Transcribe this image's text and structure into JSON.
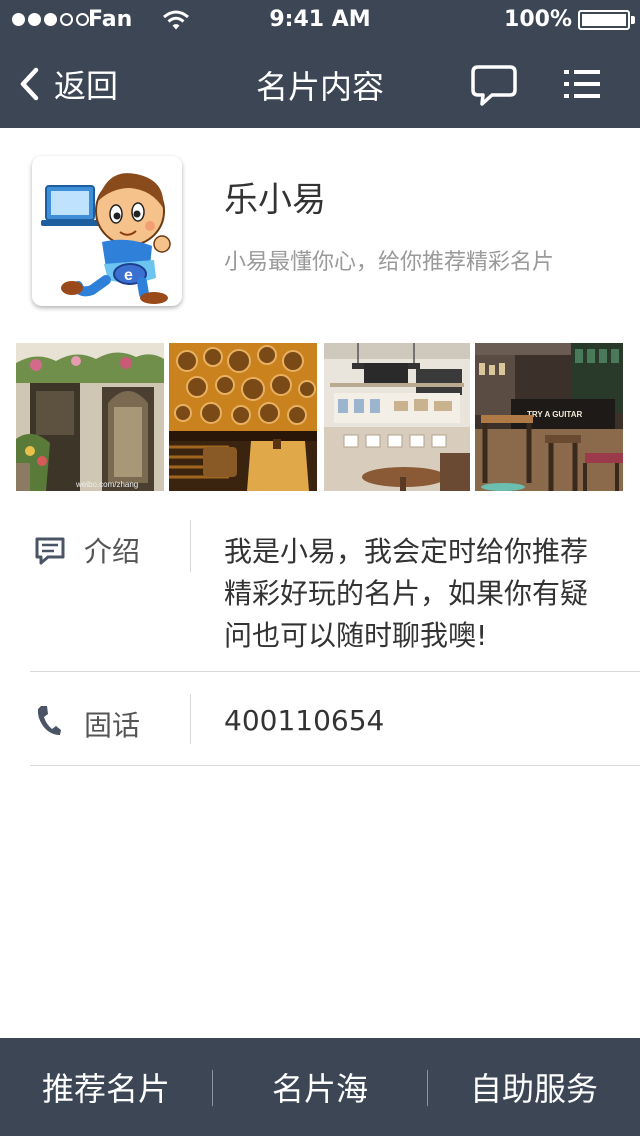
{
  "status_bar": {
    "carrier": "Fan",
    "time": "9:41 AM",
    "battery": "100%"
  },
  "nav": {
    "back_label": "返回",
    "title": "名片内容",
    "icons": [
      "chevron-left-icon",
      "chat-bubble-icon",
      "list-menu-icon"
    ]
  },
  "profile": {
    "name": "乐小易",
    "tagline": "小易最懂你心，给你推荐精彩名片",
    "avatar_icon": "cartoon-mascot-avatar"
  },
  "gallery": {
    "photos": [
      {
        "name": "flower-shop-storefront-photo",
        "watermark": "weibo.com/zhang"
      },
      {
        "name": "wall-plates-lounge-photo"
      },
      {
        "name": "cafe-counter-interior-photo"
      },
      {
        "name": "guitar-cafe-bar-photo",
        "sign": "TRY A GUITAR"
      }
    ]
  },
  "info": {
    "intro": {
      "icon": "message-icon",
      "label": "介绍",
      "lines": [
        "我是小易，我会定时给你推荐",
        "精彩好玩的名片，如果你有疑",
        "问也可以随时聊我噢!"
      ]
    },
    "phone": {
      "icon": "phone-icon",
      "label": "固话",
      "value": "400110654"
    }
  },
  "tabbar": {
    "tabs": [
      "推荐名片",
      "名片海",
      "自助服务"
    ]
  },
  "colors": {
    "bar_background": "#3c4655",
    "separator": "#d9d9d9",
    "tagline_gray": "#9a9a9a"
  }
}
